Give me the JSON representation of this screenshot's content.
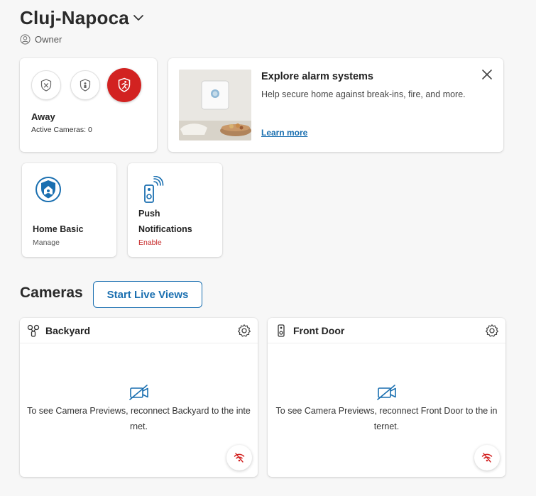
{
  "location": {
    "name": "Cluj-Napoca",
    "role": "Owner"
  },
  "mode": {
    "current_label": "Away",
    "active_cameras": "Active Cameras: 0",
    "buttons": [
      "disarmed-icon",
      "home-icon",
      "away-icon"
    ],
    "active_color": "#d22221"
  },
  "promo": {
    "title": "Explore alarm systems",
    "body": "Help secure home against break-ins, fire, and more.",
    "link": "Learn more"
  },
  "tiles": [
    {
      "title": "Home Basic",
      "sub": "Manage",
      "sub_color": "#555555"
    },
    {
      "title_line1": "Push",
      "title_line2": "Notifications",
      "sub": "Enable",
      "sub_color": "#c62828"
    }
  ],
  "cameras": {
    "title": "Cameras",
    "live_button": "Start Live Views",
    "items": [
      {
        "name": "Backyard",
        "message": "To see Camera Previews, reconnect Backyard to the internet."
      },
      {
        "name": "Front Door",
        "message": "To see Camera Previews, reconnect Front Door to the internet."
      }
    ]
  },
  "colors": {
    "accent": "#1a6fb0",
    "alert": "#d22221"
  }
}
